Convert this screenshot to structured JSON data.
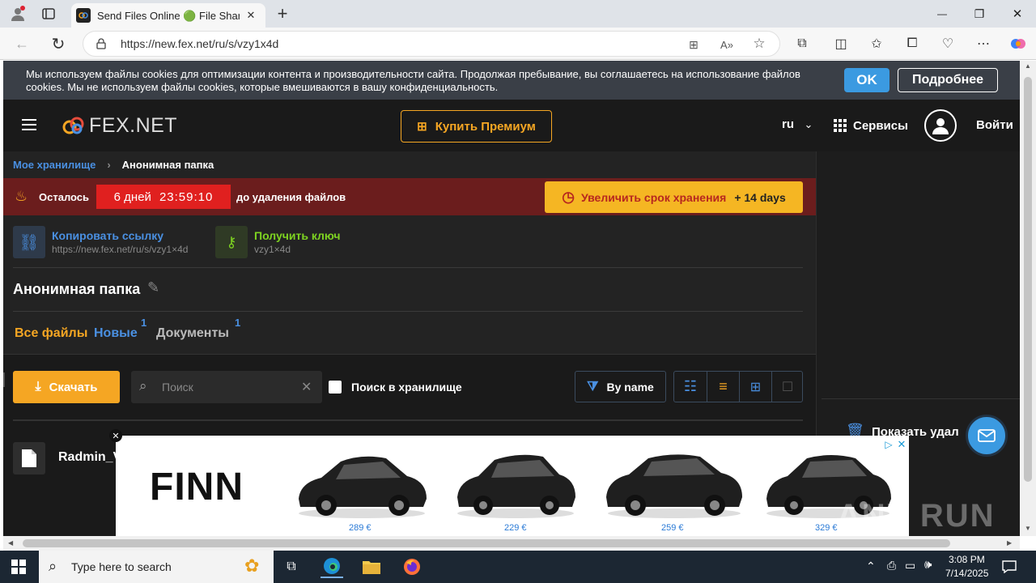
{
  "browser": {
    "tab_title": "Send Files Online 🟢 File Sharing",
    "url": "https://new.fex.net/ru/s/vzy1x4d",
    "new_tab_label": "+",
    "window_minimize": "—",
    "window_maximize": "❐",
    "window_close": "✕"
  },
  "cookie_banner": {
    "text": "Мы используем файлы cookies для оптимизации контента и производительности сайта. Продолжая пребывание, вы соглашаетесь на использование файлов cookies. Мы не используем файлы cookies, которые вмешиваются в вашу конфиденциальность.",
    "ok_label": "OK",
    "more_label": "Подробнее"
  },
  "header": {
    "logo_text": "FEX.NET",
    "premium_label": "Купить Премиум",
    "language": "ru",
    "services_label": "Сервисы",
    "login_label": "Войти"
  },
  "breadcrumb": {
    "root": "Мое хранилище",
    "current": "Анонимная папка"
  },
  "expiry": {
    "prefix": "Осталось",
    "days": "6 дней",
    "time": "23:59:10",
    "suffix": "до удаления файлов",
    "extend_label": "Увеличить срок хранения",
    "extend_bonus": "+ 14 days"
  },
  "share": {
    "copy_label": "Копировать ссылку",
    "copy_url": "https://new.fex.net/ru/s/vzy1×4d",
    "key_label": "Получить ключ",
    "key_value": "vzy1×4d"
  },
  "folder": {
    "title": "Анонимная папка"
  },
  "tabs": [
    {
      "label": "Все файлы",
      "badge": ""
    },
    {
      "label": "Новые",
      "badge": "1"
    },
    {
      "label": "Документы",
      "badge": "1"
    }
  ],
  "toolbar": {
    "download_label": "Скачать",
    "search_placeholder": "Поиск",
    "search_storage_label": "Поиск в хранилище",
    "sort_label": "By name"
  },
  "files": [
    {
      "name": "Radmin_V"
    }
  ],
  "sidebar": {
    "show_deleted_label": "Показать удал"
  },
  "ad": {
    "brand": "FINN",
    "prices": [
      "289 €",
      "229 €",
      "259 €",
      "329 €"
    ]
  },
  "watermark": "ANY RUN",
  "taskbar": {
    "search_placeholder": "Type here to search",
    "time": "3:08 PM",
    "date": "7/14/2025"
  },
  "colors": {
    "accent_orange": "#f5a623",
    "link_blue": "#4a90e2",
    "key_green": "#7ed321",
    "expiry_red": "#e0201f"
  }
}
